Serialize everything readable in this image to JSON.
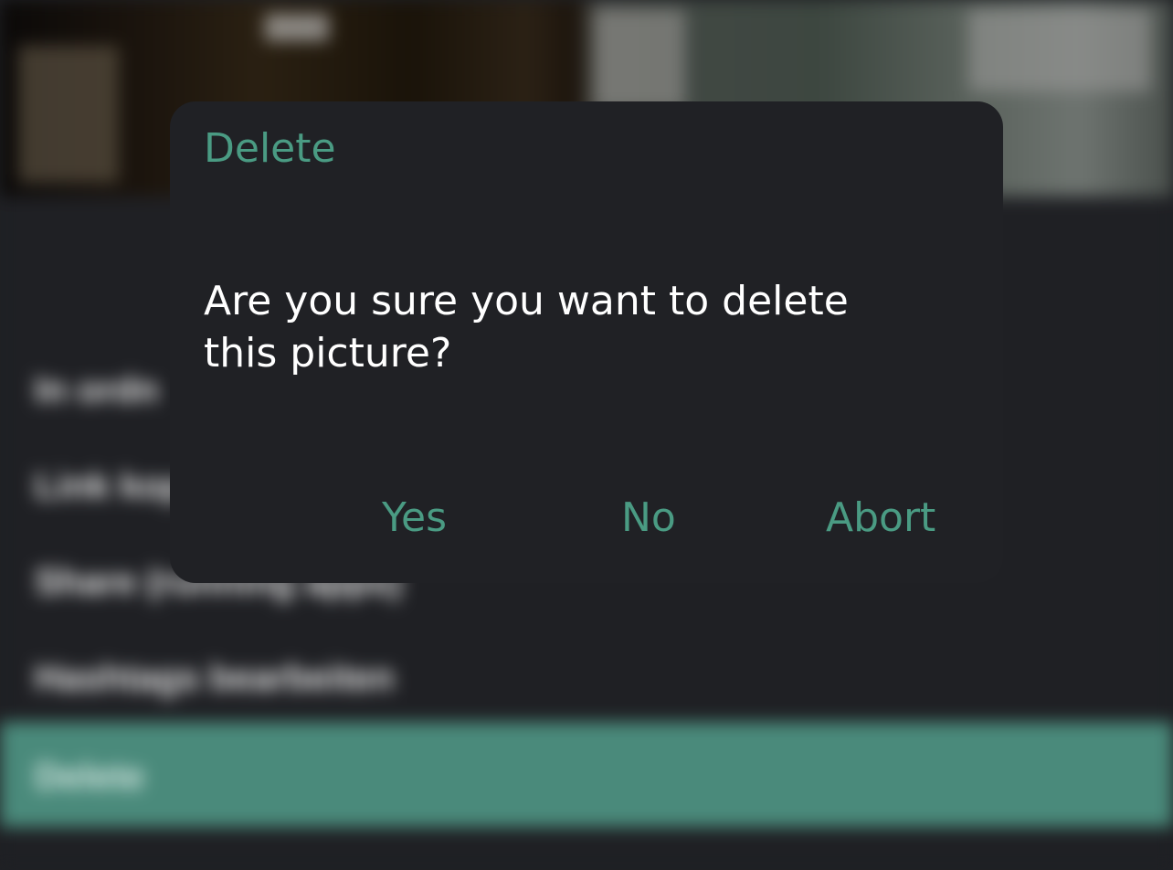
{
  "background": {
    "menu_items": [
      "In ordn",
      "Link kop",
      "Share (running apps)",
      "Hashtags bearbeiten"
    ],
    "selected_item": "Delete"
  },
  "dialog": {
    "title": "Delete",
    "message": "Are you sure you want to delete this picture?",
    "buttons": {
      "yes": "Yes",
      "no": "No",
      "abort": "Abort"
    }
  },
  "colors": {
    "accent": "#4a9b83",
    "dialog_background": "#202125",
    "selected_row": "#4a8a7b"
  }
}
